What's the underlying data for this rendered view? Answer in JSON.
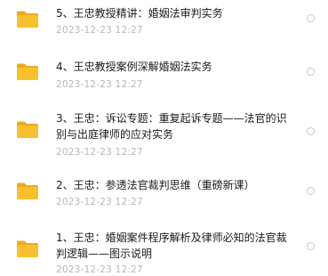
{
  "files": [
    {
      "name": "5、王忠教授精讲：婚姻法审判实务",
      "date": "2023-12-23 12:27"
    },
    {
      "name": "4、王忠教授案例深解婚姻法实务",
      "date": "2023-12-23 12:27"
    },
    {
      "name": "3、王忠：诉讼专题：重复起诉专题——法官的识别与出庭律师的应对实务",
      "date": "2023-12-23 12:27"
    },
    {
      "name": "2、王忠：参透法官裁判思维（重磅新课）",
      "date": "2023-12-23 12:27"
    },
    {
      "name": "1、王忠：婚姻案件程序解析及律师必知的法官裁判逻辑——图示说明",
      "date": "2023-12-23 12:27"
    }
  ],
  "icons": {
    "folder": "folder-icon",
    "select": "radio-circle-icon"
  },
  "colors": {
    "folder_body": "#F9C02E",
    "folder_tab": "#F0A91C",
    "date": "#B8B8B8"
  }
}
